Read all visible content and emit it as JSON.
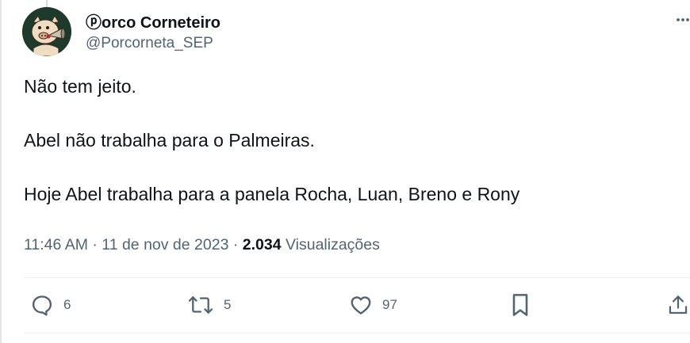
{
  "author": {
    "display_name": "ⓟorco Corneteiro",
    "handle": "@Porcorneta_SEP"
  },
  "tweet": {
    "lines": [
      "Não tem jeito.",
      "Abel não trabalha para o Palmeiras.",
      "Hoje Abel trabalha para a panela Rocha, Luan, Breno e Rony"
    ]
  },
  "meta": {
    "time": "11:46 AM",
    "separator": " · ",
    "date": "11 de nov de 2023",
    "views_count": "2.034",
    "views_label": "Visualizações"
  },
  "actions": {
    "reply_count": "6",
    "retweet_count": "5",
    "like_count": "97"
  },
  "icons": [
    "more-icon",
    "reply-icon",
    "retweet-icon",
    "like-icon",
    "bookmark-icon",
    "share-icon"
  ],
  "colors": {
    "text_primary": "#0f1419",
    "text_secondary": "#536471",
    "divider": "#eff3f4",
    "avatar_bg": "#1d3a2c"
  }
}
